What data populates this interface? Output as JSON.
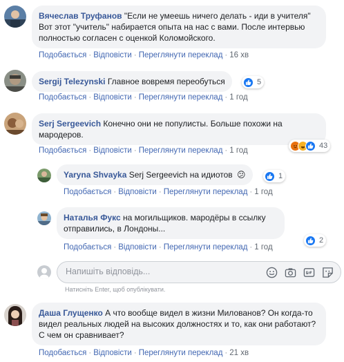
{
  "actions": {
    "like": "Подобається",
    "reply": "Відповісти",
    "translate": "Переглянути переклад",
    "separator": "·"
  },
  "comments": [
    {
      "author": "Вячеслав Труфанов",
      "text": " \"Если не умеешь ничего делать - иди в учителя\" Вот этот \"учитель\" набирается опыта на нас с вами. После интервью полностью согласен с оценкой Коломойского.",
      "time": "16 хв"
    },
    {
      "author": "Sergij Telezynski",
      "text": " Главное вовремя переобуться",
      "time": "1 год",
      "reactions": {
        "count": "5",
        "icons": [
          "like-icon"
        ]
      }
    },
    {
      "author": "Serj Sergeevich",
      "text": " Конечно они не популисты. Больше похожи на мародеров.",
      "time": "1 год",
      "reactions": {
        "count": "43",
        "icons": [
          "angry-icon",
          "haha-icon",
          "like-icon"
        ]
      }
    }
  ],
  "replies": [
    {
      "author": "Yaryna Shvayka",
      "text": " Serj Sergeevich на идиотов",
      "emoji": "😕",
      "time": "1 год",
      "reactions": {
        "count": "1",
        "icons": [
          "like-icon"
        ]
      }
    },
    {
      "author": "Наталья Фукс",
      "text": " на могильщиков. мародёры в ссылку отправились, в Лондоны...",
      "time": "1 год",
      "reactions": {
        "count": "2",
        "icons": [
          "like-icon"
        ]
      }
    }
  ],
  "composer": {
    "placeholder": "Напишіть відповідь...",
    "hint": "Натисніть Enter, щоб опублікувати.",
    "icons": [
      "emoji-icon",
      "camera-icon",
      "gif-icon",
      "sticker-icon"
    ]
  },
  "last_comment": {
    "author": "Даша Глущенко",
    "text": " А что вообще видел в жизни Милованов? Он когда-то видел реальных людей на высоких должностях и то, как они работают? С чем он сравнивает?",
    "time": "21 хв"
  }
}
